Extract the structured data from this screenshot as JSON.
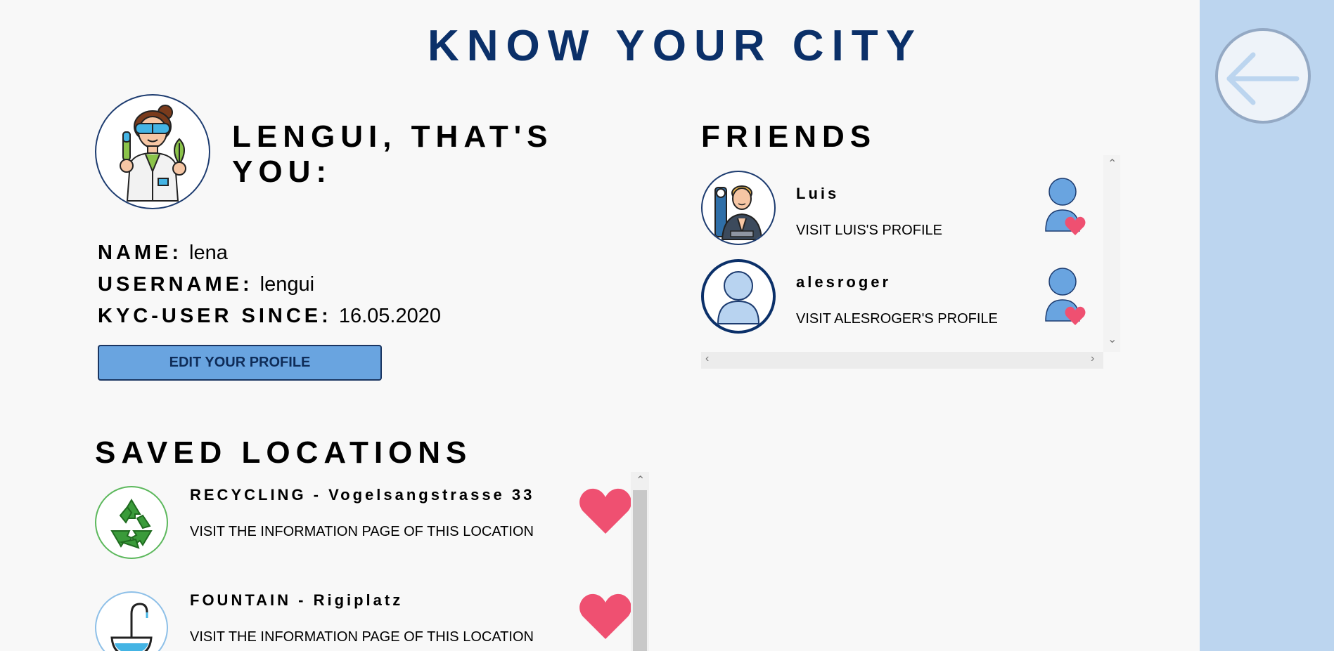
{
  "app": {
    "title": "KNOW YOUR CITY"
  },
  "profile": {
    "heading": "LENGUI, THAT'S YOU:",
    "name_label": "NAME:",
    "name_value": "lena",
    "username_label": "USERNAME:",
    "username_value": "lengui",
    "since_label": "KYC-USER SINCE:",
    "since_value": "16.05.2020",
    "edit_button": "EDIT YOUR PROFILE"
  },
  "saved": {
    "heading": "SAVED LOCATIONS",
    "items": [
      {
        "title": "RECYCLING - Vogelsangstrasse 33",
        "link": "VISIT THE INFORMATION PAGE OF THIS LOCATION",
        "icon": "recycling-icon"
      },
      {
        "title": "FOUNTAIN - Rigiplatz",
        "link": "VISIT THE INFORMATION PAGE OF THIS LOCATION",
        "icon": "fountain-icon"
      }
    ]
  },
  "friends": {
    "heading": "FRIENDS",
    "items": [
      {
        "name": "Luis",
        "link": "VISIT LUIS'S PROFILE",
        "avatar": "illustrated-avatar"
      },
      {
        "name": "alesroger",
        "link": "VISIT ALESROGER'S PROFILE",
        "avatar": "default-user-avatar"
      }
    ]
  },
  "colors": {
    "title": "#0b3069",
    "accent": "#69a4e0",
    "heart": "#ef5071",
    "sidebar": "#bcd5ef"
  }
}
